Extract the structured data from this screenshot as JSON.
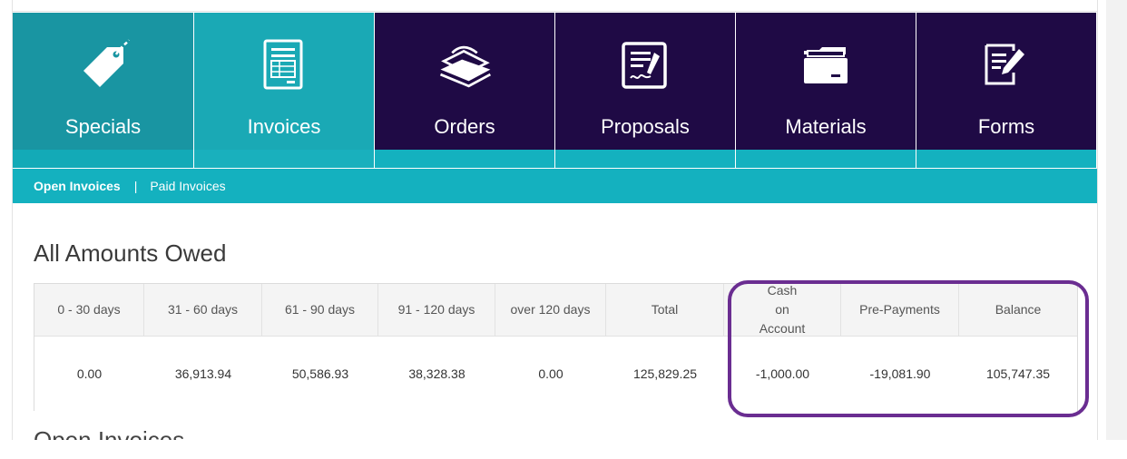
{
  "tiles": [
    {
      "key": "specials",
      "label": "Specials",
      "icon": "price-tag-icon"
    },
    {
      "key": "invoices",
      "label": "Invoices",
      "icon": "invoice-document-icon"
    },
    {
      "key": "orders",
      "label": "Orders",
      "icon": "paper-stack-icon"
    },
    {
      "key": "proposals",
      "label": "Proposals",
      "icon": "signed-document-icon"
    },
    {
      "key": "materials",
      "label": "Materials",
      "icon": "folder-icon"
    },
    {
      "key": "forms",
      "label": "Forms",
      "icon": "form-edit-icon"
    }
  ],
  "colors": {
    "teal": "#1aa9b5",
    "teal_strip": "#14b1bf",
    "purple": "#1f0a45",
    "highlight": "#6a2d91"
  },
  "subnav": {
    "open_label": "Open Invoices",
    "separator": "|",
    "paid_label": "Paid Invoices"
  },
  "section_title": "All Amounts Owed",
  "next_section_title": "Open Invoices",
  "amounts": {
    "headers": [
      "0 - 30 days",
      "31 - 60 days",
      "61 - 90 days",
      "91 - 120 days",
      "over 120 days",
      "Total",
      "Cash on Account",
      "Pre-Payments",
      "Balance"
    ],
    "values": [
      "0.00",
      "36,913.94",
      "50,586.93",
      "38,328.38",
      "0.00",
      "125,829.25",
      "-1,000.00",
      "-19,081.90",
      "105,747.35"
    ]
  }
}
